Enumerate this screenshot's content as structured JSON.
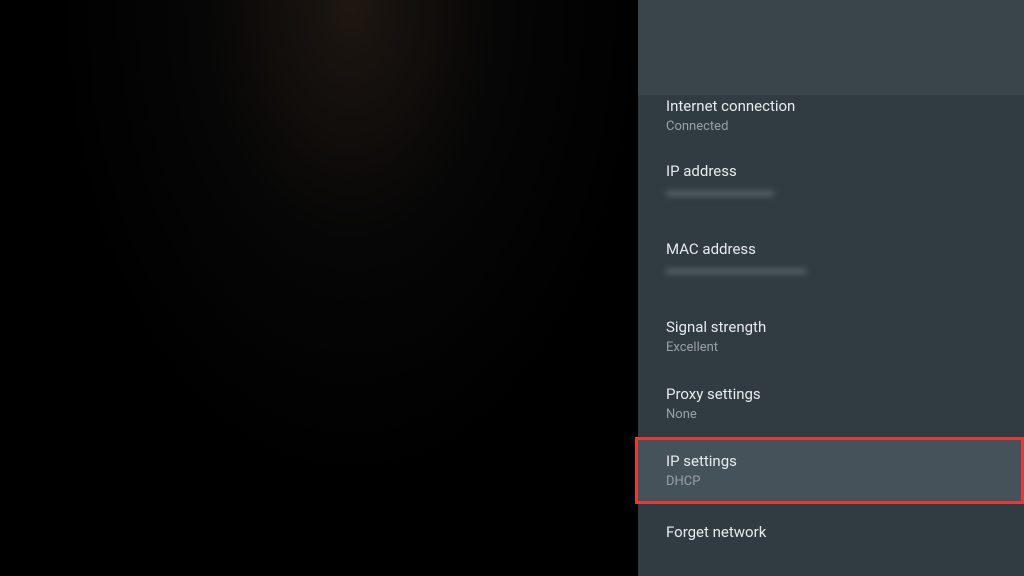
{
  "settings": {
    "internet_connection": {
      "title": "Internet connection",
      "value": "Connected"
    },
    "ip_address": {
      "title": "IP address"
    },
    "mac_address": {
      "title": "MAC address"
    },
    "signal_strength": {
      "title": "Signal strength",
      "value": "Excellent"
    },
    "proxy_settings": {
      "title": "Proxy settings",
      "value": "None"
    },
    "ip_settings": {
      "title": "IP settings",
      "value": "DHCP"
    },
    "forget_network": {
      "title": "Forget network"
    }
  }
}
